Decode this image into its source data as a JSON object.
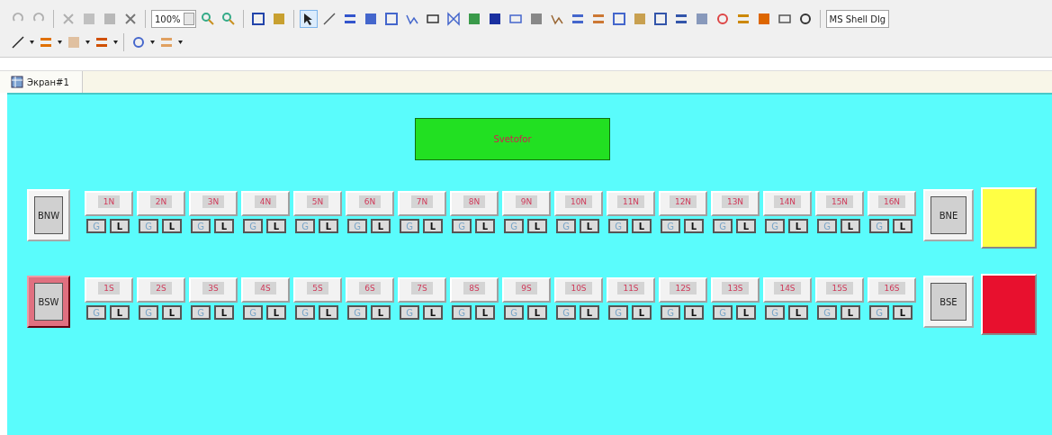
{
  "toolbar": {
    "zoom": "100%",
    "font": "MS Shell Dlg",
    "pointer_tool": {
      "selected": true
    }
  },
  "tabs": [
    {
      "label": "Экран#1",
      "selected": true
    }
  ],
  "screen": {
    "title_button": {
      "label": "Svetofor"
    },
    "rows": [
      {
        "left": {
          "label": "BNW",
          "selected": false
        },
        "right": {
          "label": "BNE",
          "selected": false
        },
        "lamp": {
          "color": "#ffff44"
        },
        "signals": [
          {
            "label": "1N",
            "g": "G",
            "l": "L"
          },
          {
            "label": "2N",
            "g": "G",
            "l": "L"
          },
          {
            "label": "3N",
            "g": "G",
            "l": "L"
          },
          {
            "label": "4N",
            "g": "G",
            "l": "L"
          },
          {
            "label": "5N",
            "g": "G",
            "l": "L"
          },
          {
            "label": "6N",
            "g": "G",
            "l": "L"
          },
          {
            "label": "7N",
            "g": "G",
            "l": "L"
          },
          {
            "label": "8N",
            "g": "G",
            "l": "L"
          },
          {
            "label": "9N",
            "g": "G",
            "l": "L"
          },
          {
            "label": "10N",
            "g": "G",
            "l": "L"
          },
          {
            "label": "11N",
            "g": "G",
            "l": "L"
          },
          {
            "label": "12N",
            "g": "G",
            "l": "L"
          },
          {
            "label": "13N",
            "g": "G",
            "l": "L"
          },
          {
            "label": "14N",
            "g": "G",
            "l": "L"
          },
          {
            "label": "15N",
            "g": "G",
            "l": "L"
          },
          {
            "label": "16N",
            "g": "G",
            "l": "L"
          }
        ]
      },
      {
        "left": {
          "label": "BSW",
          "selected": true
        },
        "right": {
          "label": "BSE",
          "selected": false
        },
        "lamp": {
          "color": "#e8102e"
        },
        "signals": [
          {
            "label": "1S",
            "g": "G",
            "l": "L"
          },
          {
            "label": "2S",
            "g": "G",
            "l": "L"
          },
          {
            "label": "3S",
            "g": "G",
            "l": "L"
          },
          {
            "label": "4S",
            "g": "G",
            "l": "L"
          },
          {
            "label": "5S",
            "g": "G",
            "l": "L"
          },
          {
            "label": "6S",
            "g": "G",
            "l": "L"
          },
          {
            "label": "7S",
            "g": "G",
            "l": "L"
          },
          {
            "label": "8S",
            "g": "G",
            "l": "L"
          },
          {
            "label": "9S",
            "g": "G",
            "l": "L"
          },
          {
            "label": "10S",
            "g": "G",
            "l": "L"
          },
          {
            "label": "11S",
            "g": "G",
            "l": "L"
          },
          {
            "label": "12S",
            "g": "G",
            "l": "L"
          },
          {
            "label": "13S",
            "g": "G",
            "l": "L"
          },
          {
            "label": "14S",
            "g": "G",
            "l": "L"
          },
          {
            "label": "15S",
            "g": "G",
            "l": "L"
          },
          {
            "label": "16S",
            "g": "G",
            "l": "L"
          }
        ]
      }
    ]
  }
}
